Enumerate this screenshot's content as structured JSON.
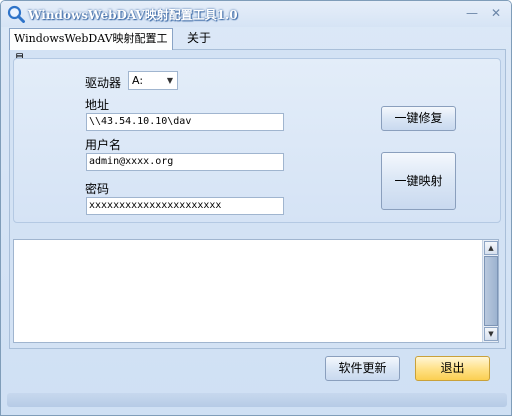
{
  "window": {
    "title": "WindowsWebDAV映射配置工具1.0",
    "minimize_label": "—",
    "close_label": "✕"
  },
  "tabs": [
    {
      "label": "WindowsWebDAV映射配置工具",
      "active": true
    },
    {
      "label": "关于",
      "active": false
    }
  ],
  "form": {
    "drive_label": "驱动器",
    "drive_value": "A:",
    "address_label": "地址",
    "address_value": "\\\\43.54.10.10\\dav",
    "username_label": "用户名",
    "username_value": "admin@xxxx.org",
    "password_label": "密码",
    "password_value": "xxxxxxxxxxxxxxxxxxxxxx"
  },
  "buttons": {
    "repair": "一键修复",
    "map": "一键映射",
    "update": "软件更新",
    "exit": "退出"
  },
  "log": {
    "content": ""
  },
  "colors": {
    "title_text": "#ffffff",
    "exit_button": "#ffe28a",
    "background": "#d3e2f4"
  }
}
